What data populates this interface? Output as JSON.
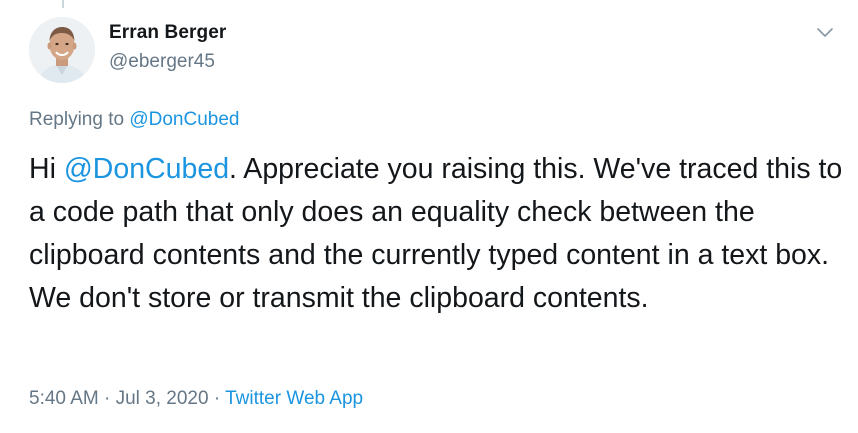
{
  "author": {
    "name": "Erran Berger",
    "handle": "@eberger45"
  },
  "reply_context": {
    "prefix": "Replying to",
    "mention": "@DonCubed"
  },
  "tweet": {
    "greeting": "Hi",
    "mention": "@DonCubed",
    "body": ". Appreciate you raising this. We've traced this to a code path that only does an equality check between the clipboard contents and the currently typed content in a text box. We don't store or transmit the clipboard contents."
  },
  "meta": {
    "time": "5:40 AM",
    "separator": "·",
    "date": "Jul 3, 2020",
    "source": "Twitter Web App"
  },
  "icons": {
    "menu": "chevron-down-icon",
    "avatar": "profile-photo"
  },
  "colors": {
    "link": "#1b95e0",
    "secondary_text": "#657786",
    "primary_text": "#14171a"
  }
}
